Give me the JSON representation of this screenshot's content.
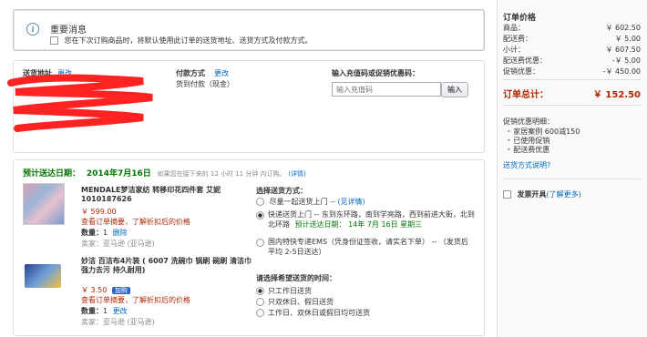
{
  "notice": {
    "icon": "info-icon",
    "title": "重要消息",
    "text": "您在下次订购商品时，将默认使用此订单的送货地址、送货方式及付款方式。"
  },
  "address": {
    "label": "送货地址",
    "change": "更改"
  },
  "payment": {
    "label": "付款方式",
    "change": "更改",
    "value": "货到付款（现金）"
  },
  "promo": {
    "label": "输入充值码或促销优惠码：",
    "placeholder": "输入充值码",
    "button": "输入"
  },
  "delivery": {
    "estimate_label": "预计送达日期：",
    "date": "2014年7月16日",
    "countdown": "如果您在接下来的 12 小时 11 分钟 内订购。",
    "details": "(详情)"
  },
  "items": [
    {
      "title": "MENDALE梦洁家纺 转移印花四件套 艾妮 1010187626",
      "price": "￥ 599.00",
      "discount_link": "查看订单摘要，了解折扣后的价格",
      "qty_label": "数量：",
      "qty": "1",
      "remove": "删除",
      "seller": "卖家：亚马逊 (亚马逊)"
    },
    {
      "title": "妙洁 百洁布4片装 ( 6007 洗碗巾 锅刷 碗刷 清洁巾 强力去污 持久耐用)",
      "price": "￥ 3.50",
      "badge": "加购",
      "discount_link": "查看订单摘要，了解折扣后的价格",
      "qty_label": "数量：",
      "qty": "1",
      "change": "更改",
      "seller": "卖家：亚马逊 (亚马逊)"
    }
  ],
  "shipping_method": {
    "title": "选择送货方式：",
    "options": [
      {
        "text": "尽量一起送货上门 -- ",
        "link": "(见详情)",
        "selected": false
      },
      {
        "text": "快递送货上门 -- 东到东环路，南到学亮路，西到前进大街，北到北环路",
        "extra": "预计送达日期： 14年 7月 16日 星期三",
        "selected": true
      },
      {
        "text": "国内特快专递EMS（凭身份证签收，请实名下单） -- （发货后平均 2-5日送达）",
        "selected": false
      }
    ]
  },
  "delivery_time": {
    "title": "请选择希望送货的时间：",
    "options": [
      {
        "text": "只工作日送货",
        "selected": true
      },
      {
        "text": "只双休日、假日送货",
        "selected": false
      },
      {
        "text": "工作日、双休日或假日均可送货",
        "selected": false
      }
    ]
  },
  "summary": {
    "title": "订单价格",
    "rows": [
      {
        "label": "商品：",
        "value": "￥ 602.50"
      },
      {
        "label": "配送费：",
        "value": "￥ 5.00"
      },
      {
        "label": "小计：",
        "value": "￥ 607.50"
      },
      {
        "label": "配送费优惠：",
        "value": "-￥ 5.00"
      },
      {
        "label": "促销优惠：",
        "value": "-￥ 450.00"
      }
    ],
    "total_label": "订单总计：",
    "total_value": "￥ 152.50",
    "promo_title": "促销优惠明细：",
    "promo_items": [
      "家居案例 600减150",
      "已使用促销",
      "配送费优惠"
    ],
    "promo_link": "送货方式说明?",
    "invoice_label": "发票开具",
    "invoice_link": "(了解更多)"
  },
  "colors": {
    "accent_red": "#b12704",
    "green": "#007600",
    "link": "#0066c0"
  }
}
